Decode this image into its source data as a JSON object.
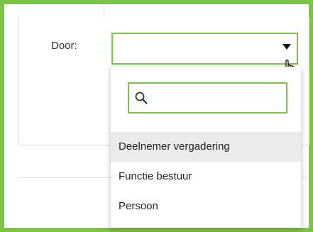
{
  "form": {
    "door_label": "Door:"
  },
  "select": {
    "selected_value": "",
    "arrow_icon": "chevron-down-icon",
    "cursor_icon": "hand-pointer-icon"
  },
  "dropdown": {
    "search": {
      "icon": "search-icon",
      "value": "",
      "placeholder": ""
    },
    "options": [
      {
        "label": "Deelnemer vergadering",
        "highlighted": true
      },
      {
        "label": "Functie bestuur",
        "highlighted": false
      },
      {
        "label": "Persoon",
        "highlighted": false
      }
    ]
  },
  "colors": {
    "accent": "#7cc444",
    "highlight": "#ebebeb"
  }
}
